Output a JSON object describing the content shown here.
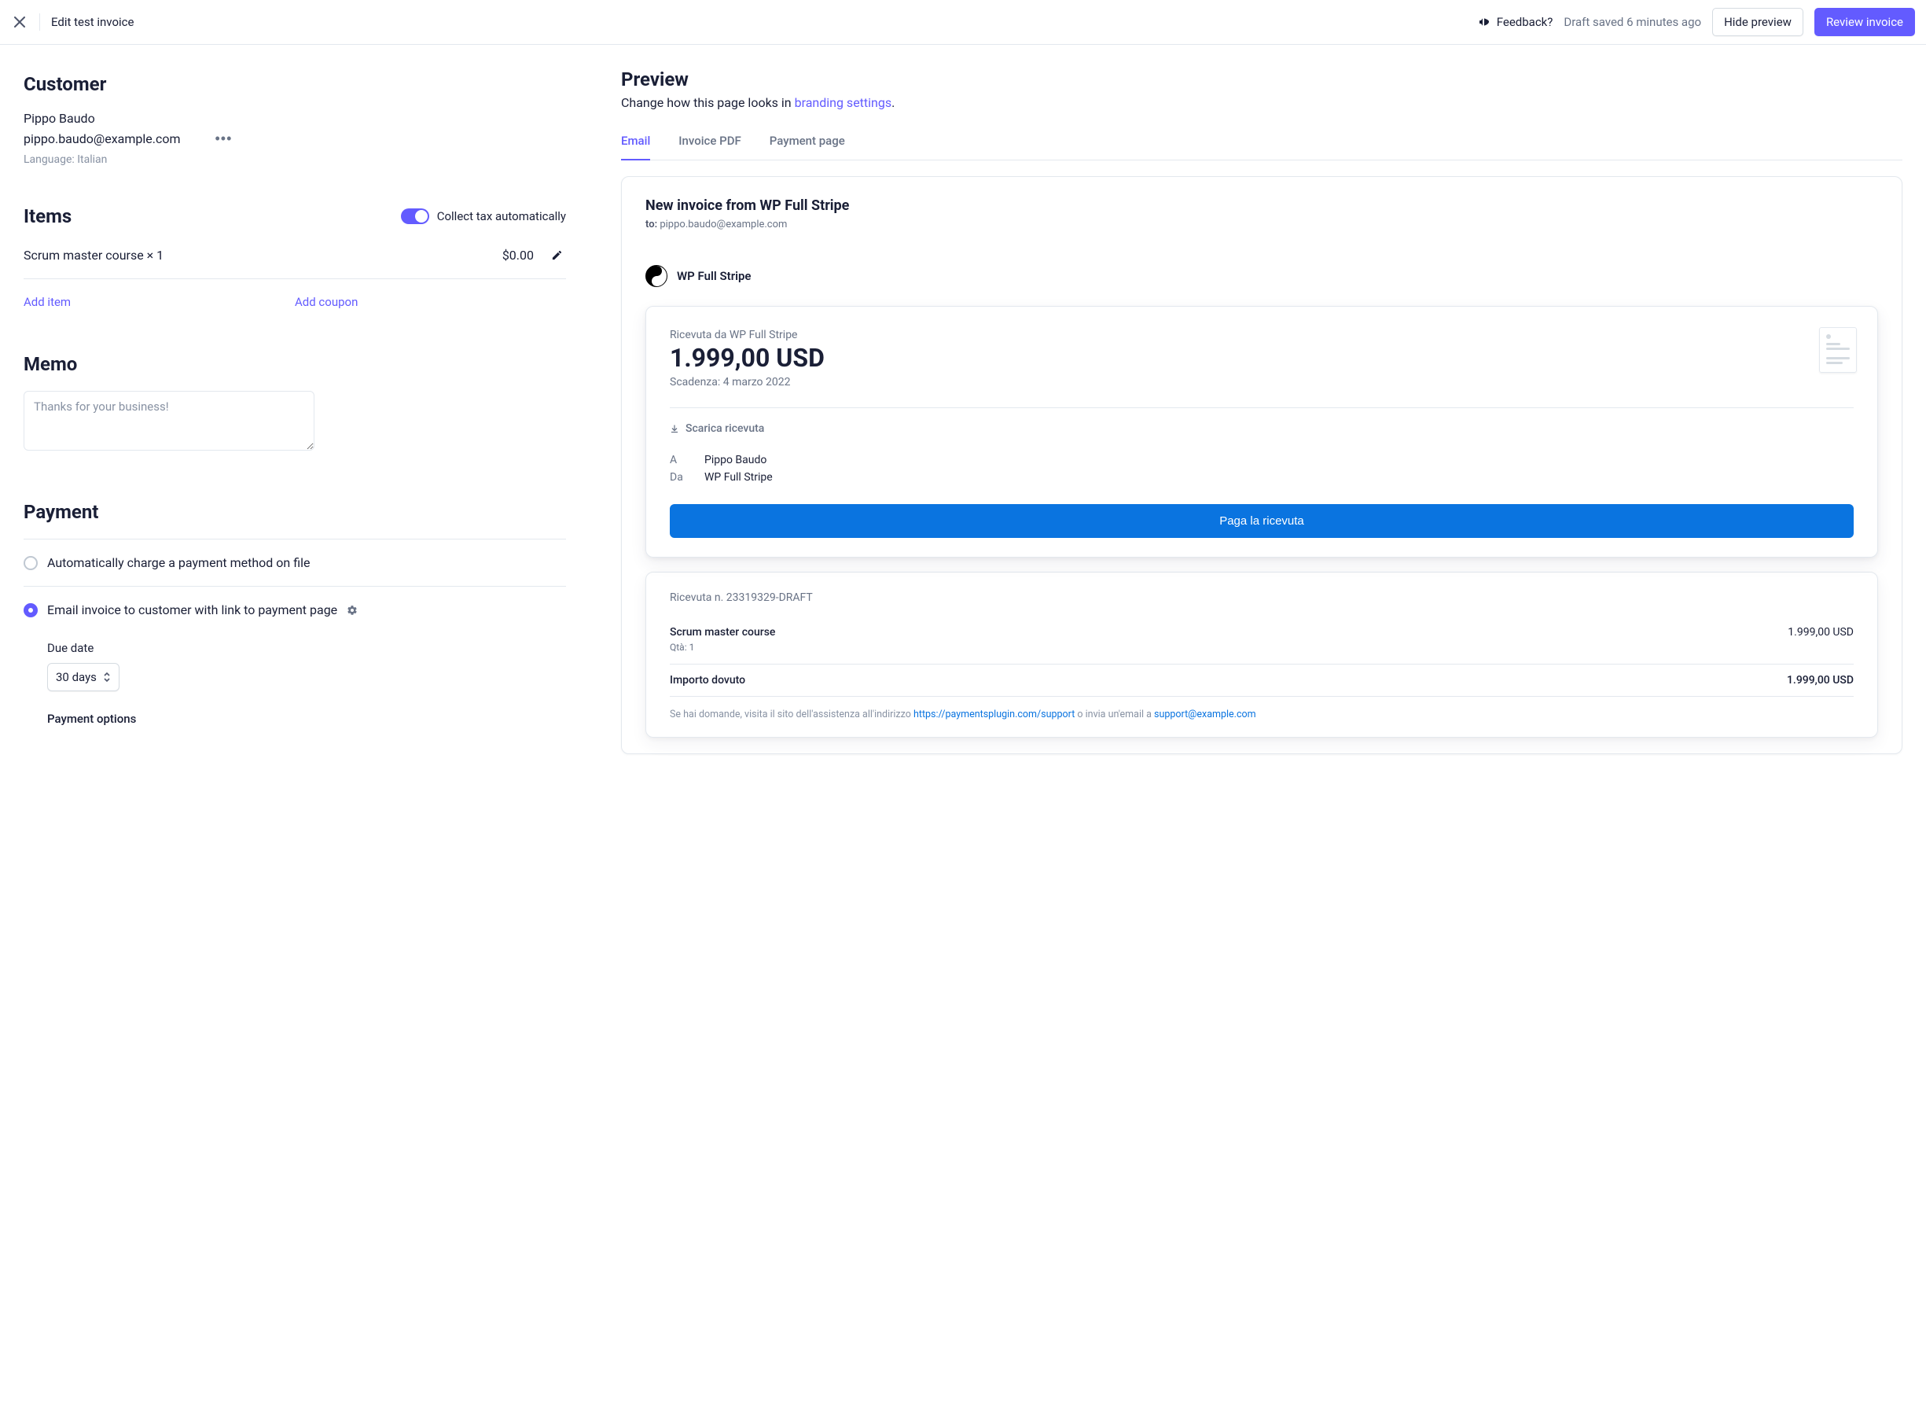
{
  "header": {
    "title": "Edit test invoice",
    "feedback": "Feedback?",
    "draft_status": "Draft saved 6 minutes ago",
    "hide_preview": "Hide preview",
    "review": "Review invoice"
  },
  "customer": {
    "heading": "Customer",
    "name": "Pippo Baudo",
    "email": "pippo.baudo@example.com",
    "language": "Language: Italian"
  },
  "items": {
    "heading": "Items",
    "collect_tax": "Collect tax automatically",
    "line": {
      "name": "Scrum master course × 1",
      "price": "$0.00"
    },
    "add_item": "Add item",
    "add_coupon": "Add coupon"
  },
  "memo": {
    "heading": "Memo",
    "placeholder": "Thanks for your business!"
  },
  "payment": {
    "heading": "Payment",
    "opt_auto": "Automatically charge a payment method on file",
    "opt_email": "Email invoice to customer with link to payment page",
    "due_label": "Due date",
    "due_value": "30 days",
    "options_label": "Payment options"
  },
  "preview": {
    "heading": "Preview",
    "sub_pre": "Change how this page looks in ",
    "sub_link": "branding settings",
    "sub_post": ".",
    "tabs": {
      "email": "Email",
      "pdf": "Invoice PDF",
      "page": "Payment page"
    },
    "card": {
      "title": "New invoice from WP Full Stripe",
      "to_label": "to:",
      "to_value": "pippo.baudo@example.com",
      "brand": "WP Full Stripe",
      "receipt_from": "Ricevuta da WP Full Stripe",
      "amount": "1.999,00 USD",
      "due": "Scadenza: 4 marzo 2022",
      "download": "Scarica ricevuta",
      "a_label": "A",
      "a_value": "Pippo Baudo",
      "da_label": "Da",
      "da_value": "WP Full Stripe",
      "pay_btn": "Paga la ricevuta",
      "rec_n": "Ricevuta n. 23319329-DRAFT",
      "li_name": "Scrum master course",
      "li_price": "1.999,00 USD",
      "li_qty": "Qtà: 1",
      "total_label": "Importo dovuto",
      "total_value": "1.999,00 USD",
      "sup_pre": "Se hai domande, visita il sito dell'assistenza all'indirizzo ",
      "sup_link": "https://paymentsplugin.com/support",
      "sup_mid": " o invia un'email a ",
      "sup_email": "support@example.com"
    }
  }
}
